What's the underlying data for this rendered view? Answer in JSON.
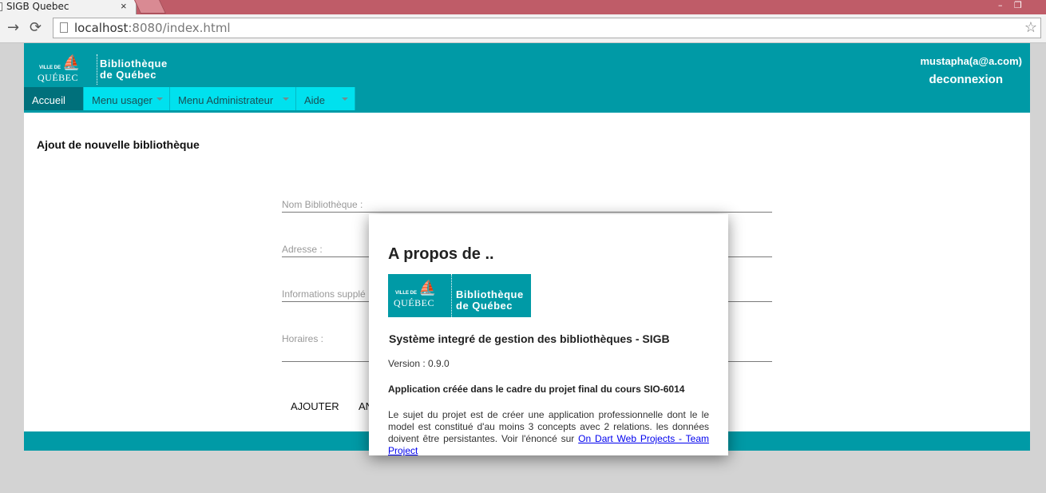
{
  "browser": {
    "tab_title": "SIGB Quebec",
    "tab_close": "×",
    "url_host": "localhost",
    "url_rest": ":8080/index.html",
    "win_min": "–",
    "win_max": "❐"
  },
  "header": {
    "logo_small": "VILLE DE",
    "logo_big": "QUÉBEC",
    "logo_line1": "Bibliothèque",
    "logo_line2": "de Québec",
    "user_email": "mustapha(a@a.com)",
    "logout_label": "deconnexion"
  },
  "menu": {
    "items": [
      {
        "label": "Accueil"
      },
      {
        "label": "Menu usager"
      },
      {
        "label": "Menu Administrateur"
      },
      {
        "label": "Aide"
      }
    ]
  },
  "main": {
    "title": "Ajout de nouvelle bibliothèque",
    "fields": [
      {
        "label": "Nom Bibliothèque :"
      },
      {
        "label": "Adresse :"
      },
      {
        "label": "Informations supplé"
      },
      {
        "label": "Horaires :"
      }
    ],
    "add_label": "AJOUTER",
    "cancel_label": "AN"
  },
  "modal": {
    "title": "A propos de ..",
    "subtitle": "Système integré de gestion des bibliothèques - SIGB",
    "version": "Version : 0.9.0",
    "app_line": "Application créée dans le cadre du projet final du cours SIO-6014",
    "desc": "Le sujet du projet est de créer une application professionnelle dont le le model est constitué d'au moins 3 concepts avec 2 relations. les données doivent être persistantes. Voir l'énoncé sur",
    "link": "On Dart Web Projects - Team Project"
  },
  "colors": {
    "brand": "#009aa6",
    "menu": "#00e1ee",
    "menu_active": "#00707b"
  }
}
